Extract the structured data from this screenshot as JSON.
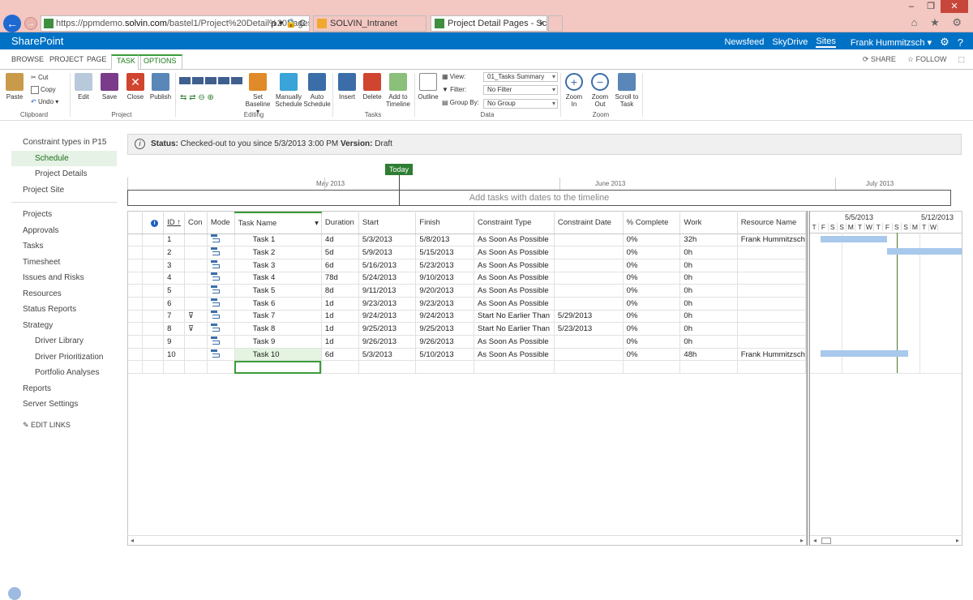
{
  "browser": {
    "url_prefix": "https://ppmdemo.",
    "url_domain": "solvin.com",
    "url_rest": "/bastel1/Project%20Detail%20Pages/Sch",
    "url_tools": "ρ ▾ 🔒 C",
    "tab1": "SOLVIN_Intranet",
    "tab2": "Project Detail Pages - Sched...",
    "tab2_close": "×",
    "minimize": "–",
    "maximize": "❐",
    "close": "✕",
    "icons": "⌂ ★ ⚙"
  },
  "suitebar": {
    "brand": "SharePoint",
    "newsfeed": "Newsfeed",
    "skydrive": "SkyDrive",
    "sites": "Sites",
    "user": "Frank Hummitzsch ▾",
    "gear": "⚙",
    "help": "?"
  },
  "ribbon_tabs": {
    "browse": "BROWSE",
    "project": "PROJECT",
    "page": "PAGE",
    "task": "TASK",
    "options": "OPTIONS",
    "share": "SHARE",
    "follow": "FOLLOW"
  },
  "ribbon": {
    "paste": "Paste",
    "cut": "Cut",
    "copy": "Copy",
    "undo": "Undo ▾",
    "clipboard": "Clipboard",
    "edit": "Edit",
    "save": "Save",
    "close": "Close",
    "publish": "Publish",
    "project": "Project",
    "zoom_chips": [
      "0%",
      "25%",
      "50%",
      "75%",
      "100%"
    ],
    "set_baseline": "Set Baseline ▾",
    "manually_schedule": "Manually Schedule",
    "auto_schedule": "Auto Schedule",
    "editing": "Editing",
    "insert": "Insert",
    "delete": "Delete",
    "add_to_timeline": "Add to Timeline",
    "tasks": "Tasks",
    "outline": "Outline",
    "view_label": "View:",
    "view_value": "01_Tasks Summary",
    "filter_label": "Filter:",
    "filter_value": "No Filter",
    "groupby_label": "Group By:",
    "groupby_value": "No Group",
    "data": "Data",
    "zoom_in": "Zoom In",
    "zoom_out": "Zoom Out",
    "scroll_to_task": "Scroll to Task",
    "zoom": "Zoom"
  },
  "leftnav": {
    "items": [
      {
        "label": "Constraint types in P15",
        "level": 0
      },
      {
        "label": "Schedule",
        "level": 1,
        "selected": true
      },
      {
        "label": "Project Details",
        "level": 1
      },
      {
        "label": "Project Site",
        "level": 0
      },
      {
        "label": "Projects",
        "level": 0
      },
      {
        "label": "Approvals",
        "level": 0
      },
      {
        "label": "Tasks",
        "level": 0
      },
      {
        "label": "Timesheet",
        "level": 0
      },
      {
        "label": "Issues and Risks",
        "level": 0
      },
      {
        "label": "Resources",
        "level": 0
      },
      {
        "label": "Status Reports",
        "level": 0
      },
      {
        "label": "Strategy",
        "level": 0
      },
      {
        "label": "Driver Library",
        "level": 1
      },
      {
        "label": "Driver Prioritization",
        "level": 1
      },
      {
        "label": "Portfolio Analyses",
        "level": 1
      },
      {
        "label": "Reports",
        "level": 0
      },
      {
        "label": "Server Settings",
        "level": 0
      }
    ],
    "edit_links": "EDIT LINKS"
  },
  "status": {
    "label": "Status:",
    "text": " Checked-out to you since 5/3/2013 3:00 PM ",
    "version_label": "Version:",
    "version": " Draft"
  },
  "timeline": {
    "today": "Today",
    "months": [
      "May 2013",
      "June 2013",
      "July 2013"
    ],
    "placeholder": "Add tasks with dates to the timeline"
  },
  "grid": {
    "columns": [
      "",
      "ID ↑",
      "Con",
      "Mode",
      "Task Name",
      "Duration",
      "Start",
      "Finish",
      "Constraint Type",
      "Constraint Date",
      "% Complete",
      "Work",
      "Resource Name"
    ],
    "rows": [
      {
        "id": "1",
        "con": "",
        "name": "Task 1",
        "duration": "4d",
        "start": "5/3/2013",
        "finish": "5/8/2013",
        "ctype": "As Soon As Possible",
        "cdate": "",
        "pct": "0%",
        "work": "32h",
        "resource": "Frank Hummitzsch"
      },
      {
        "id": "2",
        "con": "",
        "name": "Task 2",
        "duration": "5d",
        "start": "5/9/2013",
        "finish": "5/15/2013",
        "ctype": "As Soon As Possible",
        "cdate": "",
        "pct": "0%",
        "work": "0h",
        "resource": ""
      },
      {
        "id": "3",
        "con": "",
        "name": "Task 3",
        "duration": "6d",
        "start": "5/16/2013",
        "finish": "5/23/2013",
        "ctype": "As Soon As Possible",
        "cdate": "",
        "pct": "0%",
        "work": "0h",
        "resource": ""
      },
      {
        "id": "4",
        "con": "",
        "name": "Task 4",
        "duration": "78d",
        "start": "5/24/2013",
        "finish": "9/10/2013",
        "ctype": "As Soon As Possible",
        "cdate": "",
        "pct": "0%",
        "work": "0h",
        "resource": ""
      },
      {
        "id": "5",
        "con": "",
        "name": "Task 5",
        "duration": "8d",
        "start": "9/11/2013",
        "finish": "9/20/2013",
        "ctype": "As Soon As Possible",
        "cdate": "",
        "pct": "0%",
        "work": "0h",
        "resource": ""
      },
      {
        "id": "6",
        "con": "",
        "name": "Task 6",
        "duration": "1d",
        "start": "9/23/2013",
        "finish": "9/23/2013",
        "ctype": "As Soon As Possible",
        "cdate": "",
        "pct": "0%",
        "work": "0h",
        "resource": ""
      },
      {
        "id": "7",
        "con": "⊽",
        "name": "Task 7",
        "duration": "1d",
        "start": "9/24/2013",
        "finish": "9/24/2013",
        "ctype": "Start No Earlier Than",
        "cdate": "5/29/2013",
        "pct": "0%",
        "work": "0h",
        "resource": ""
      },
      {
        "id": "8",
        "con": "⊽",
        "name": "Task 8",
        "duration": "1d",
        "start": "9/25/2013",
        "finish": "9/25/2013",
        "ctype": "Start No Earlier Than",
        "cdate": "5/23/2013",
        "pct": "0%",
        "work": "0h",
        "resource": ""
      },
      {
        "id": "9",
        "con": "",
        "name": "Task 9",
        "duration": "1d",
        "start": "9/26/2013",
        "finish": "9/26/2013",
        "ctype": "As Soon As Possible",
        "cdate": "",
        "pct": "0%",
        "work": "0h",
        "resource": ""
      },
      {
        "id": "10",
        "con": "",
        "name": "Task 10",
        "duration": "6d",
        "start": "5/3/2013",
        "finish": "5/10/2013",
        "ctype": "As Soon As Possible",
        "cdate": "",
        "pct": "0%",
        "work": "48h",
        "resource": "Frank Hummitzsch"
      }
    ]
  },
  "gantt": {
    "weeks": [
      "5/5/2013",
      "5/12/2013"
    ],
    "days": [
      "T",
      "F",
      "S",
      "S",
      "M",
      "T",
      "W",
      "T",
      "F",
      "S",
      "S",
      "M",
      "T",
      "W"
    ]
  },
  "scroll": {
    "left": "◂",
    "right": "▸"
  }
}
